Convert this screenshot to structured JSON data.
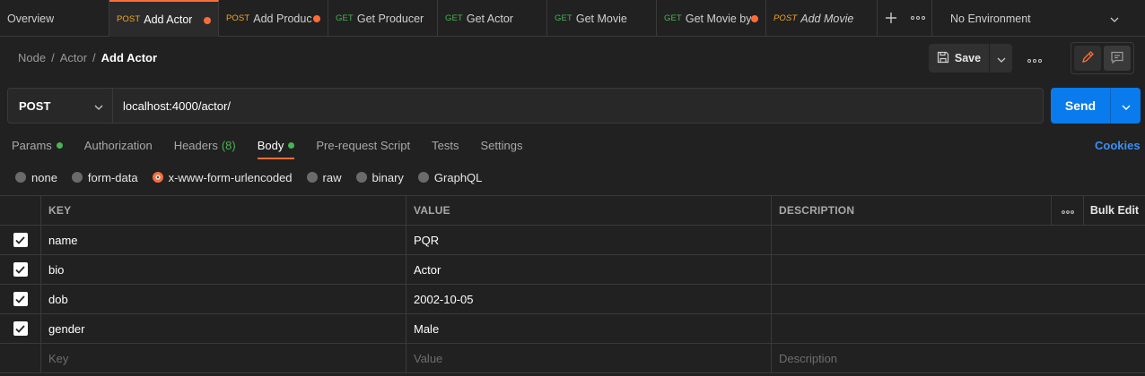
{
  "tabs": [
    {
      "label": "Overview"
    },
    {
      "method": "POST",
      "label": "Add Actor",
      "active": true,
      "dot": true
    },
    {
      "method": "POST",
      "label": "Add Produc",
      "dot": true
    },
    {
      "method": "GET",
      "label": "Get Producer"
    },
    {
      "method": "GET",
      "label": "Get Actor"
    },
    {
      "method": "GET",
      "label": "Get Movie"
    },
    {
      "method": "GET",
      "label": "Get Movie by",
      "dot": true
    },
    {
      "method": "POST",
      "label": "Add Movie",
      "italic": true
    }
  ],
  "tab_actions": {
    "add_icon": "plus-icon",
    "more_icon": "more-icon"
  },
  "environment": {
    "label": "No Environment"
  },
  "breadcrumb": {
    "part1": "Node",
    "sep": "/",
    "part2": "Actor",
    "current": "Add Actor"
  },
  "toolbar": {
    "save_label": "Save"
  },
  "request": {
    "method": "POST",
    "url": "localhost:4000/actor/",
    "send_label": "Send"
  },
  "subtabs": {
    "params": "Params",
    "authorization": "Authorization",
    "headers": "Headers",
    "headers_count": "(8)",
    "body": "Body",
    "prerequest": "Pre-request Script",
    "tests": "Tests",
    "settings": "Settings",
    "cookies": "Cookies"
  },
  "body_types": {
    "none": "none",
    "form_data": "form-data",
    "urlencoded": "x-www-form-urlencoded",
    "raw": "raw",
    "binary": "binary",
    "graphql": "GraphQL",
    "selected": "x-www-form-urlencoded"
  },
  "table": {
    "headers": {
      "key": "KEY",
      "value": "VALUE",
      "description": "DESCRIPTION",
      "bulk_edit": "Bulk Edit"
    },
    "rows": [
      {
        "key": "name",
        "value": "PQR",
        "checked": true
      },
      {
        "key": "bio",
        "value": "Actor",
        "checked": true
      },
      {
        "key": "dob",
        "value": "2002-10-05",
        "checked": true
      },
      {
        "key": "gender",
        "value": "Male",
        "checked": true
      }
    ],
    "placeholders": {
      "key": "Key",
      "value": "Value",
      "description": "Description"
    }
  },
  "colors": {
    "accent": "#ff6c37",
    "send": "#097bed",
    "get": "#49b454",
    "post": "#f5a623"
  }
}
